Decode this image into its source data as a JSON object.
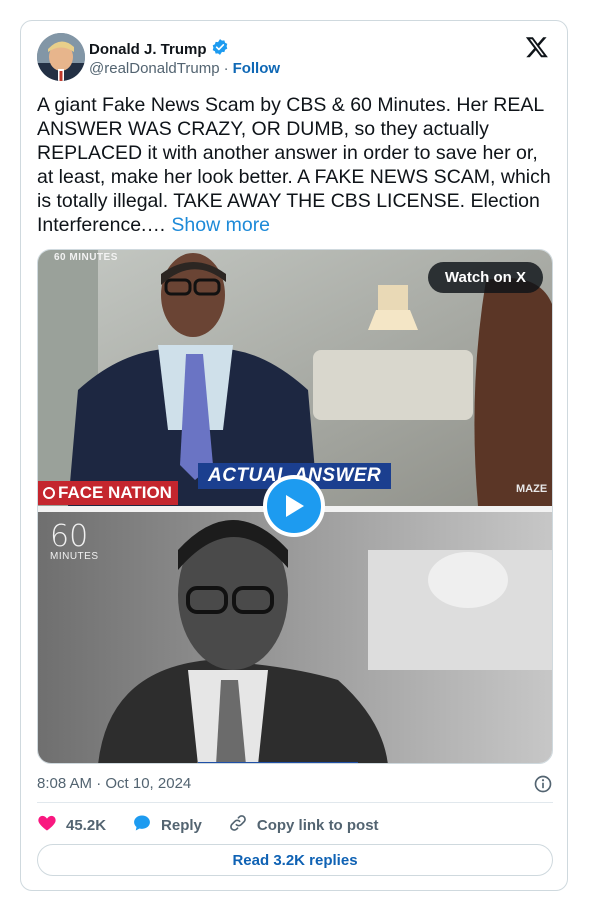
{
  "author": {
    "display_name": "Donald J. Trump",
    "handle": "@realDonaldTrump",
    "separator": "·",
    "follow_label": "Follow"
  },
  "tweet": {
    "text": "A giant Fake News Scam by CBS & 60 Minutes. Her REAL ANSWER WAS CRAZY, OR DUMB, so they actually REPLACED it with another answer in order to save her or, at least, make her look better. A FAKE NEWS SCAM, which is totally illegal. TAKE AWAY THE CBS LICENSE. Election Interference.…",
    "show_more": "Show more"
  },
  "media": {
    "watch_label": "Watch on X",
    "top_logo": "60 MINUTES",
    "banner": "ACTUAL ANSWER",
    "face_nation": "FACE NATION",
    "watermark": "MAZE",
    "bottom_logo_num": "60",
    "bottom_logo_word": "MINUTES"
  },
  "meta": {
    "time": "8:08 AM · Oct 10, 2024"
  },
  "actions": {
    "likes": "45.2K",
    "reply_label": "Reply",
    "copy_label": "Copy link to post"
  },
  "replies_button": "Read 3.2K replies",
  "colors": {
    "like": "#f91880",
    "reply": "#1d9bf0",
    "verified": "#1d9bf0",
    "play": "#1d9bf0"
  }
}
